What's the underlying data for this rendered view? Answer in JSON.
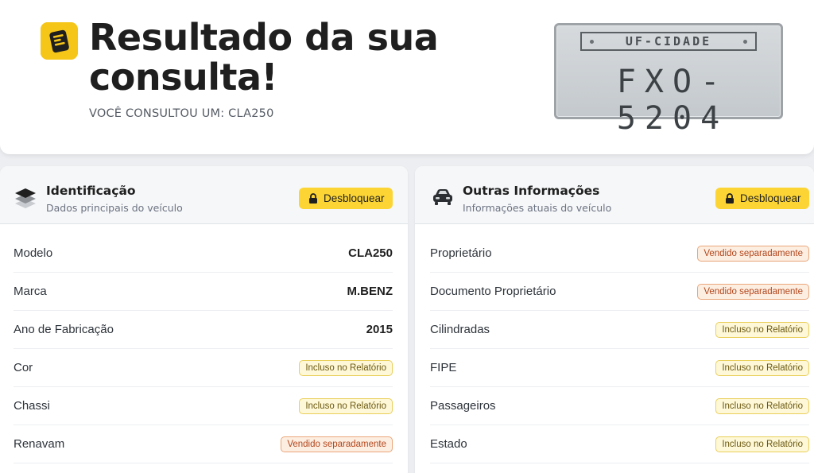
{
  "header": {
    "title": "Resultado da sua consulta!",
    "subtitle": "VOCÊ CONSULTOU UM: CLA250",
    "logo_icon": "document-icon"
  },
  "plate": {
    "region": "UF-CIDADE",
    "number": "FXO-5204"
  },
  "identificacao": {
    "icon": "layers-icon",
    "title": "Identificação",
    "subtitle": "Dados principais do veículo",
    "unlock_label": "Desbloquear",
    "rows": [
      {
        "label": "Modelo",
        "value": "CLA250",
        "type": "value"
      },
      {
        "label": "Marca",
        "value": "M.BENZ",
        "type": "value"
      },
      {
        "label": "Ano de Fabricação",
        "value": "2015",
        "type": "value"
      },
      {
        "label": "Cor",
        "value": "Incluso no Relatório",
        "type": "included"
      },
      {
        "label": "Chassi",
        "value": "Incluso no Relatório",
        "type": "included"
      },
      {
        "label": "Renavam",
        "value": "Vendido separadamente",
        "type": "separate"
      }
    ]
  },
  "outras": {
    "icon": "car-icon",
    "title": "Outras Informações",
    "subtitle": "Informações atuais do veículo",
    "unlock_label": "Desbloquear",
    "rows": [
      {
        "label": "Proprietário",
        "value": "Vendido separadamente",
        "type": "separate"
      },
      {
        "label": "Documento Proprietário",
        "value": "Vendido separadamente",
        "type": "separate"
      },
      {
        "label": "Cilindradas",
        "value": "Incluso no Relatório",
        "type": "included"
      },
      {
        "label": "FIPE",
        "value": "Incluso no Relatório",
        "type": "included"
      },
      {
        "label": "Passageiros",
        "value": "Incluso no Relatório",
        "type": "included"
      },
      {
        "label": "Estado",
        "value": "Incluso no Relatório",
        "type": "included"
      }
    ]
  },
  "colors": {
    "accent": "#fcd535",
    "included_bg": "#fef8d8",
    "separate_bg": "#fdeee2"
  }
}
